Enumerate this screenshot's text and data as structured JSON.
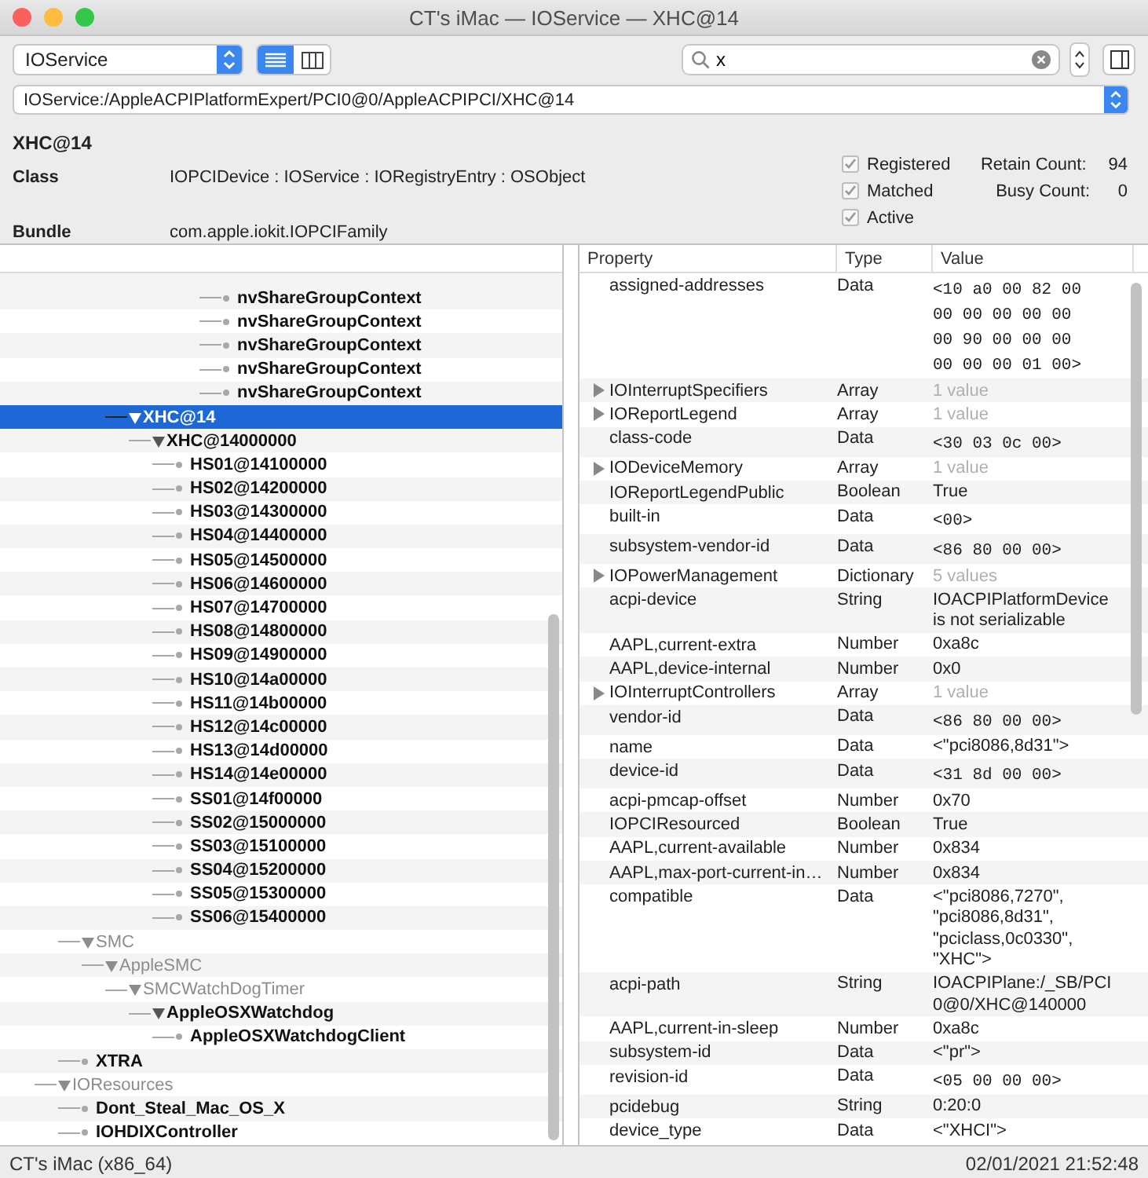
{
  "window": {
    "title": "CT's iMac — IOService — XHC@14"
  },
  "toolbar": {
    "plane_popup": "IOService",
    "view_modes": [
      {
        "kind": "list",
        "selected": true
      },
      {
        "kind": "columns",
        "selected": false
      }
    ],
    "search": {
      "value": "x"
    }
  },
  "path": "IOService:/AppleACPIPlatformExpert/PCI0@0/AppleACPIPCI/XHC@14",
  "details": {
    "name": "XHC@14",
    "fields": [
      {
        "label": "Class",
        "value": "IOPCIDevice : IOService : IORegistryEntry : OSObject"
      },
      {
        "label": "Bundle",
        "value": "com.apple.iokit.IOPCIFamily"
      }
    ],
    "flags": [
      {
        "label": "Registered",
        "checked": true
      },
      {
        "label": "Matched",
        "checked": true
      },
      {
        "label": "Active",
        "checked": true
      }
    ],
    "counts": [
      {
        "label": "Retain Count:",
        "value": "94"
      },
      {
        "label": "Busy Count:",
        "value": "0"
      }
    ]
  },
  "tree": [
    {
      "children": [
        {
          "children": [
            {
              "children": [
                {
                  "children": [
                    {
                      "children": [
                        {
                          "children": [
                            {
                              "children": [
                                {
                                  "label": "nvShareGroupContext",
                                  "dimmed": false,
                                  "selected": false
                                },
                                {
                                  "label": "nvShareGroupContext",
                                  "dimmed": false,
                                  "selected": false
                                },
                                {
                                  "label": "nvShareGroupContext",
                                  "dimmed": false,
                                  "selected": false
                                },
                                {
                                  "label": "nvShareGroupContext",
                                  "dimmed": false,
                                  "selected": false
                                },
                                {
                                  "label": "nvShareGroupContext",
                                  "dimmed": false,
                                  "selected": false
                                }
                              ]
                            }
                          ]
                        }
                      ]
                    }
                  ]
                },
                {
                  "label": "XHC@14",
                  "dimmed": false,
                  "selected": true,
                  "expanded": true,
                  "children": [
                    {
                      "label": "XHC@14000000",
                      "dimmed": false,
                      "selected": false,
                      "expanded": true,
                      "children": [
                        {
                          "label": "HS01@14100000",
                          "dimmed": false,
                          "selected": false
                        },
                        {
                          "label": "HS02@14200000",
                          "dimmed": false,
                          "selected": false
                        },
                        {
                          "label": "HS03@14300000",
                          "dimmed": false,
                          "selected": false
                        },
                        {
                          "label": "HS04@14400000",
                          "dimmed": false,
                          "selected": false
                        },
                        {
                          "label": "HS05@14500000",
                          "dimmed": false,
                          "selected": false
                        },
                        {
                          "label": "HS06@14600000",
                          "dimmed": false,
                          "selected": false
                        },
                        {
                          "label": "HS07@14700000",
                          "dimmed": false,
                          "selected": false
                        },
                        {
                          "label": "HS08@14800000",
                          "dimmed": false,
                          "selected": false
                        },
                        {
                          "label": "HS09@14900000",
                          "dimmed": false,
                          "selected": false
                        },
                        {
                          "label": "HS10@14a00000",
                          "dimmed": false,
                          "selected": false
                        },
                        {
                          "label": "HS11@14b00000",
                          "dimmed": false,
                          "selected": false
                        },
                        {
                          "label": "HS12@14c00000",
                          "dimmed": false,
                          "selected": false
                        },
                        {
                          "label": "HS13@14d00000",
                          "dimmed": false,
                          "selected": false
                        },
                        {
                          "label": "HS14@14e00000",
                          "dimmed": false,
                          "selected": false
                        },
                        {
                          "label": "SS01@14f00000",
                          "dimmed": false,
                          "selected": false
                        },
                        {
                          "label": "SS02@15000000",
                          "dimmed": false,
                          "selected": false
                        },
                        {
                          "label": "SS03@15100000",
                          "dimmed": false,
                          "selected": false
                        },
                        {
                          "label": "SS04@15200000",
                          "dimmed": false,
                          "selected": false
                        },
                        {
                          "label": "SS05@15300000",
                          "dimmed": false,
                          "selected": false
                        },
                        {
                          "label": "SS06@15400000",
                          "dimmed": false,
                          "selected": false
                        }
                      ]
                    }
                  ]
                }
              ]
            }
          ]
        },
        {
          "label": "SMC",
          "dimmed": true,
          "selected": false,
          "expanded": true,
          "children": [
            {
              "label": "AppleSMC",
              "dimmed": true,
              "selected": false,
              "expanded": true,
              "children": [
                {
                  "label": "SMCWatchDogTimer",
                  "dimmed": true,
                  "selected": false,
                  "expanded": true,
                  "children": [
                    {
                      "label": "AppleOSXWatchdog",
                      "dimmed": false,
                      "selected": false,
                      "expanded": true,
                      "children": [
                        {
                          "label": "AppleOSXWatchdogClient",
                          "dimmed": false,
                          "selected": false
                        }
                      ]
                    }
                  ]
                }
              ]
            }
          ]
        },
        {
          "label": "XTRA",
          "dimmed": false,
          "selected": false
        }
      ]
    },
    {
      "label": "IOResources",
      "dimmed": true,
      "selected": false,
      "expanded": true,
      "children": [
        {
          "label": "Dont_Steal_Mac_OS_X",
          "dimmed": false,
          "selected": false
        },
        {
          "label": "IOHDIXController",
          "dimmed": false,
          "selected": false
        }
      ]
    }
  ],
  "properties": {
    "columns": [
      "Property",
      "Type",
      "Value"
    ],
    "rows": [
      {
        "name": "assigned-addresses",
        "type": "Data",
        "value": "<10 a0 00 82 00 00 00 00 00 00 00 90 00 00 00 00 00 00 01 00>",
        "kind": "hex"
      },
      {
        "name": "IOInterruptSpecifiers",
        "type": "Array",
        "value": "1 value",
        "kind": "summary",
        "expanded": false
      },
      {
        "name": "IOReportLegend",
        "type": "Array",
        "value": "1 value",
        "kind": "summary",
        "expanded": false
      },
      {
        "name": "class-code",
        "type": "Data",
        "value": "<30 03 0c 00>",
        "kind": "hex"
      },
      {
        "name": "IODeviceMemory",
        "type": "Array",
        "value": "1 value",
        "kind": "summary",
        "expanded": false
      },
      {
        "name": "IOReportLegendPublic",
        "type": "Boolean",
        "value": "True",
        "kind": "text"
      },
      {
        "name": "built-in",
        "type": "Data",
        "value": "<00>",
        "kind": "hex"
      },
      {
        "name": "subsystem-vendor-id",
        "type": "Data",
        "value": "<86 80 00 00>",
        "kind": "hex"
      },
      {
        "name": "IOPowerManagement",
        "type": "Dictionary",
        "value": "5 values",
        "kind": "summary",
        "expanded": false
      },
      {
        "name": "acpi-device",
        "type": "String",
        "value": "IOACPIPlatformDevice is not serializable",
        "kind": "text"
      },
      {
        "name": "AAPL,current-extra",
        "type": "Number",
        "value": "0xa8c",
        "kind": "text"
      },
      {
        "name": "AAPL,device-internal",
        "type": "Number",
        "value": "0x0",
        "kind": "text"
      },
      {
        "name": "IOInterruptControllers",
        "type": "Array",
        "value": "1 value",
        "kind": "summary",
        "expanded": false
      },
      {
        "name": "vendor-id",
        "type": "Data",
        "value": "<86 80 00 00>",
        "kind": "hex"
      },
      {
        "name": "name",
        "type": "Data",
        "value": "<\"pci8086,8d31\">",
        "kind": "text"
      },
      {
        "name": "device-id",
        "type": "Data",
        "value": "<31 8d 00 00>",
        "kind": "hex"
      },
      {
        "name": "acpi-pmcap-offset",
        "type": "Number",
        "value": "0x70",
        "kind": "text"
      },
      {
        "name": "IOPCIResourced",
        "type": "Boolean",
        "value": "True",
        "kind": "text"
      },
      {
        "name": "AAPL,current-available",
        "type": "Number",
        "value": "0x834",
        "kind": "text"
      },
      {
        "name": "AAPL,max-port-current-in…",
        "type": "Number",
        "value": "0x834",
        "kind": "text"
      },
      {
        "name": "compatible",
        "type": "Data",
        "value": "<\"pci8086,7270\", \"pci8086,8d31\", \"pciclass,0c0330\", \"XHC\">",
        "kind": "text"
      },
      {
        "name": "acpi-path",
        "type": "String",
        "value": "IOACPIPlane:/_SB/PCI0@0/XHC@140000",
        "kind": "text"
      },
      {
        "name": "AAPL,current-in-sleep",
        "type": "Number",
        "value": "0xa8c",
        "kind": "text"
      },
      {
        "name": "subsystem-id",
        "type": "Data",
        "value": "<\"pr\">",
        "kind": "text"
      },
      {
        "name": "revision-id",
        "type": "Data",
        "value": "<05 00 00 00>",
        "kind": "hex"
      },
      {
        "name": "pcidebug",
        "type": "String",
        "value": "0:20:0",
        "kind": "text"
      },
      {
        "name": "device_type",
        "type": "Data",
        "value": "<\"XHCI\">",
        "kind": "text"
      }
    ]
  },
  "status_bar": {
    "machine": "CT's iMac (x86_64)",
    "timestamp": "02/01/2021 21:52:48"
  }
}
